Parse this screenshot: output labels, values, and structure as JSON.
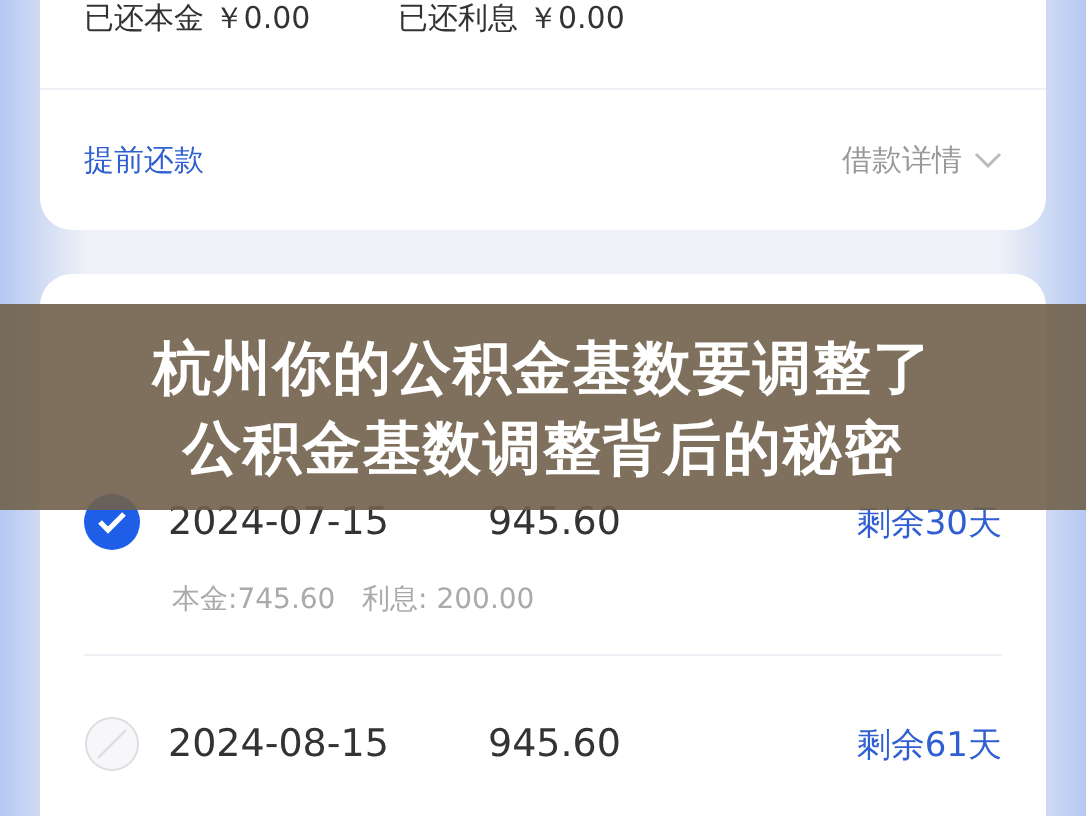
{
  "summary": [
    {
      "label": "已还本金",
      "value": "￥0.00"
    },
    {
      "label": "已还利息",
      "value": "￥0.00"
    }
  ],
  "actions": {
    "prepay": "提前还款",
    "details": "借款详情"
  },
  "schedule": {
    "rows": [
      {
        "checked": true,
        "date": "2024-07-15",
        "amount": "945.60",
        "remaining": "剩余30天",
        "breakdown": "本金:745.60   利息: 200.00"
      },
      {
        "checked": false,
        "date": "2024-08-15",
        "amount": "945.60",
        "remaining": "剩余61天"
      }
    ]
  },
  "banner": {
    "lines": [
      "杭州你的公积金基数要调整了",
      "公积金基数调整背后的秘密"
    ]
  }
}
